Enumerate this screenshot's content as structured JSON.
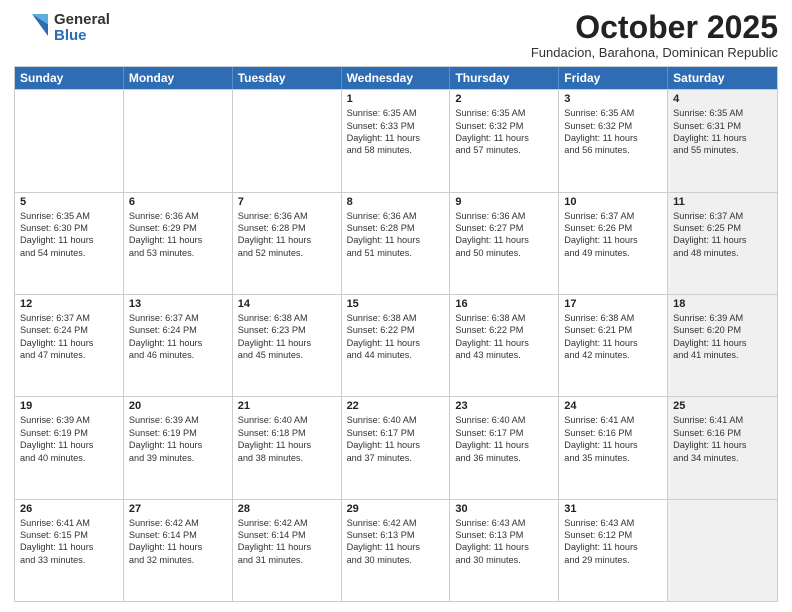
{
  "logo": {
    "general": "General",
    "blue": "Blue"
  },
  "title": "October 2025",
  "subtitle": "Fundacion, Barahona, Dominican Republic",
  "header_days": [
    "Sunday",
    "Monday",
    "Tuesday",
    "Wednesday",
    "Thursday",
    "Friday",
    "Saturday"
  ],
  "rows": [
    [
      {
        "day": "",
        "lines": [],
        "shaded": false
      },
      {
        "day": "",
        "lines": [],
        "shaded": false
      },
      {
        "day": "",
        "lines": [],
        "shaded": false
      },
      {
        "day": "1",
        "lines": [
          "Sunrise: 6:35 AM",
          "Sunset: 6:33 PM",
          "Daylight: 11 hours",
          "and 58 minutes."
        ],
        "shaded": false
      },
      {
        "day": "2",
        "lines": [
          "Sunrise: 6:35 AM",
          "Sunset: 6:32 PM",
          "Daylight: 11 hours",
          "and 57 minutes."
        ],
        "shaded": false
      },
      {
        "day": "3",
        "lines": [
          "Sunrise: 6:35 AM",
          "Sunset: 6:32 PM",
          "Daylight: 11 hours",
          "and 56 minutes."
        ],
        "shaded": false
      },
      {
        "day": "4",
        "lines": [
          "Sunrise: 6:35 AM",
          "Sunset: 6:31 PM",
          "Daylight: 11 hours",
          "and 55 minutes."
        ],
        "shaded": true
      }
    ],
    [
      {
        "day": "5",
        "lines": [
          "Sunrise: 6:35 AM",
          "Sunset: 6:30 PM",
          "Daylight: 11 hours",
          "and 54 minutes."
        ],
        "shaded": false
      },
      {
        "day": "6",
        "lines": [
          "Sunrise: 6:36 AM",
          "Sunset: 6:29 PM",
          "Daylight: 11 hours",
          "and 53 minutes."
        ],
        "shaded": false
      },
      {
        "day": "7",
        "lines": [
          "Sunrise: 6:36 AM",
          "Sunset: 6:28 PM",
          "Daylight: 11 hours",
          "and 52 minutes."
        ],
        "shaded": false
      },
      {
        "day": "8",
        "lines": [
          "Sunrise: 6:36 AM",
          "Sunset: 6:28 PM",
          "Daylight: 11 hours",
          "and 51 minutes."
        ],
        "shaded": false
      },
      {
        "day": "9",
        "lines": [
          "Sunrise: 6:36 AM",
          "Sunset: 6:27 PM",
          "Daylight: 11 hours",
          "and 50 minutes."
        ],
        "shaded": false
      },
      {
        "day": "10",
        "lines": [
          "Sunrise: 6:37 AM",
          "Sunset: 6:26 PM",
          "Daylight: 11 hours",
          "and 49 minutes."
        ],
        "shaded": false
      },
      {
        "day": "11",
        "lines": [
          "Sunrise: 6:37 AM",
          "Sunset: 6:25 PM",
          "Daylight: 11 hours",
          "and 48 minutes."
        ],
        "shaded": true
      }
    ],
    [
      {
        "day": "12",
        "lines": [
          "Sunrise: 6:37 AM",
          "Sunset: 6:24 PM",
          "Daylight: 11 hours",
          "and 47 minutes."
        ],
        "shaded": false
      },
      {
        "day": "13",
        "lines": [
          "Sunrise: 6:37 AM",
          "Sunset: 6:24 PM",
          "Daylight: 11 hours",
          "and 46 minutes."
        ],
        "shaded": false
      },
      {
        "day": "14",
        "lines": [
          "Sunrise: 6:38 AM",
          "Sunset: 6:23 PM",
          "Daylight: 11 hours",
          "and 45 minutes."
        ],
        "shaded": false
      },
      {
        "day": "15",
        "lines": [
          "Sunrise: 6:38 AM",
          "Sunset: 6:22 PM",
          "Daylight: 11 hours",
          "and 44 minutes."
        ],
        "shaded": false
      },
      {
        "day": "16",
        "lines": [
          "Sunrise: 6:38 AM",
          "Sunset: 6:22 PM",
          "Daylight: 11 hours",
          "and 43 minutes."
        ],
        "shaded": false
      },
      {
        "day": "17",
        "lines": [
          "Sunrise: 6:38 AM",
          "Sunset: 6:21 PM",
          "Daylight: 11 hours",
          "and 42 minutes."
        ],
        "shaded": false
      },
      {
        "day": "18",
        "lines": [
          "Sunrise: 6:39 AM",
          "Sunset: 6:20 PM",
          "Daylight: 11 hours",
          "and 41 minutes."
        ],
        "shaded": true
      }
    ],
    [
      {
        "day": "19",
        "lines": [
          "Sunrise: 6:39 AM",
          "Sunset: 6:19 PM",
          "Daylight: 11 hours",
          "and 40 minutes."
        ],
        "shaded": false
      },
      {
        "day": "20",
        "lines": [
          "Sunrise: 6:39 AM",
          "Sunset: 6:19 PM",
          "Daylight: 11 hours",
          "and 39 minutes."
        ],
        "shaded": false
      },
      {
        "day": "21",
        "lines": [
          "Sunrise: 6:40 AM",
          "Sunset: 6:18 PM",
          "Daylight: 11 hours",
          "and 38 minutes."
        ],
        "shaded": false
      },
      {
        "day": "22",
        "lines": [
          "Sunrise: 6:40 AM",
          "Sunset: 6:17 PM",
          "Daylight: 11 hours",
          "and 37 minutes."
        ],
        "shaded": false
      },
      {
        "day": "23",
        "lines": [
          "Sunrise: 6:40 AM",
          "Sunset: 6:17 PM",
          "Daylight: 11 hours",
          "and 36 minutes."
        ],
        "shaded": false
      },
      {
        "day": "24",
        "lines": [
          "Sunrise: 6:41 AM",
          "Sunset: 6:16 PM",
          "Daylight: 11 hours",
          "and 35 minutes."
        ],
        "shaded": false
      },
      {
        "day": "25",
        "lines": [
          "Sunrise: 6:41 AM",
          "Sunset: 6:16 PM",
          "Daylight: 11 hours",
          "and 34 minutes."
        ],
        "shaded": true
      }
    ],
    [
      {
        "day": "26",
        "lines": [
          "Sunrise: 6:41 AM",
          "Sunset: 6:15 PM",
          "Daylight: 11 hours",
          "and 33 minutes."
        ],
        "shaded": false
      },
      {
        "day": "27",
        "lines": [
          "Sunrise: 6:42 AM",
          "Sunset: 6:14 PM",
          "Daylight: 11 hours",
          "and 32 minutes."
        ],
        "shaded": false
      },
      {
        "day": "28",
        "lines": [
          "Sunrise: 6:42 AM",
          "Sunset: 6:14 PM",
          "Daylight: 11 hours",
          "and 31 minutes."
        ],
        "shaded": false
      },
      {
        "day": "29",
        "lines": [
          "Sunrise: 6:42 AM",
          "Sunset: 6:13 PM",
          "Daylight: 11 hours",
          "and 30 minutes."
        ],
        "shaded": false
      },
      {
        "day": "30",
        "lines": [
          "Sunrise: 6:43 AM",
          "Sunset: 6:13 PM",
          "Daylight: 11 hours",
          "and 30 minutes."
        ],
        "shaded": false
      },
      {
        "day": "31",
        "lines": [
          "Sunrise: 6:43 AM",
          "Sunset: 6:12 PM",
          "Daylight: 11 hours",
          "and 29 minutes."
        ],
        "shaded": false
      },
      {
        "day": "",
        "lines": [],
        "shaded": true
      }
    ]
  ]
}
